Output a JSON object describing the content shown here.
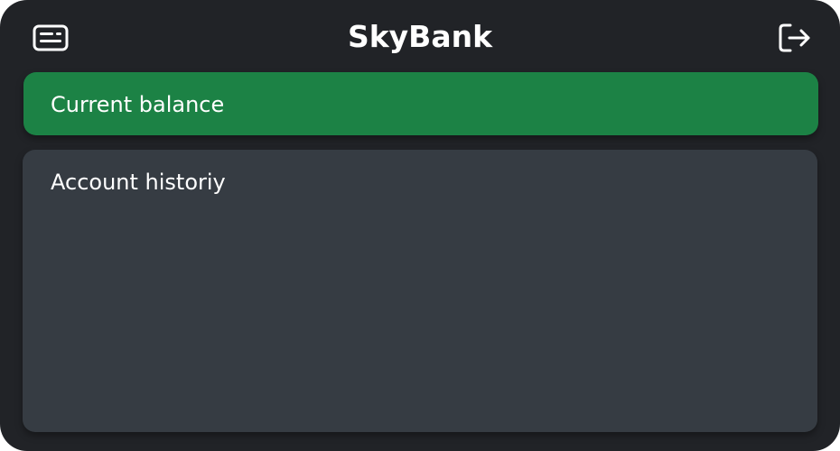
{
  "app": {
    "title": "SkyBank",
    "icons": {
      "left": "id-card-icon",
      "right": "logout-icon"
    }
  },
  "balance": {
    "label": "Current balance"
  },
  "history": {
    "label": "Account historiy"
  },
  "colors": {
    "background": "#212327",
    "balance_panel": "#1c8245",
    "history_panel": "#363c43",
    "text": "#ffffff"
  }
}
